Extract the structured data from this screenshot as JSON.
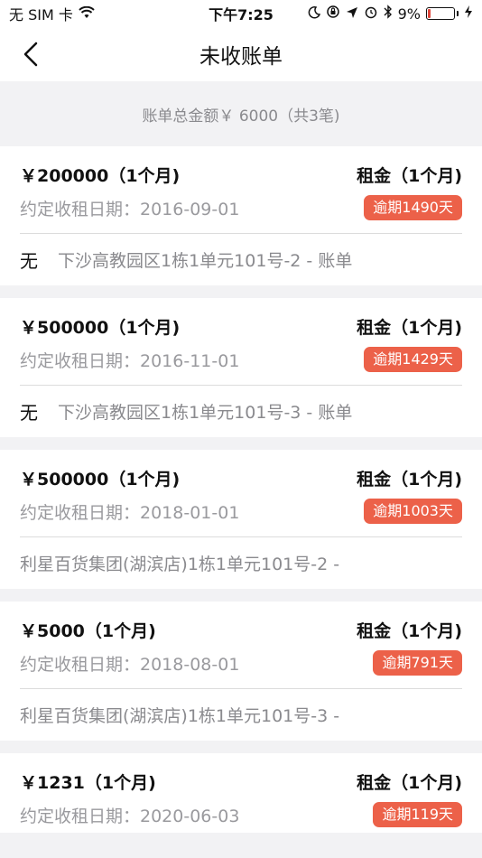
{
  "status_bar": {
    "carrier": "无 SIM 卡",
    "time": "下午7:25",
    "battery_percent": "9%",
    "battery_level": 0.09
  },
  "nav": {
    "title": "未收账单"
  },
  "summary": {
    "text": "账单总金额￥ 6000（共3笔)"
  },
  "bills": [
    {
      "amount": "￥200000（1个月)",
      "type": "租金（1个月)",
      "date": "约定收租日期：2016-09-01",
      "overdue": "逾期1490天",
      "tenant": "无",
      "address": "下沙高教园区1栋1单元101号-2 - 账单"
    },
    {
      "amount": "￥500000（1个月)",
      "type": "租金（1个月)",
      "date": "约定收租日期：2016-11-01",
      "overdue": "逾期1429天",
      "tenant": "无",
      "address": "下沙高教园区1栋1单元101号-3 - 账单"
    },
    {
      "amount": "￥500000（1个月)",
      "type": "租金（1个月)",
      "date": "约定收租日期：2018-01-01",
      "overdue": "逾期1003天",
      "tenant": "",
      "address": "利星百货集团(湖滨店)1栋1单元101号-2 -"
    },
    {
      "amount": "￥5000（1个月)",
      "type": "租金（1个月)",
      "date": "约定收租日期：2018-08-01",
      "overdue": "逾期791天",
      "tenant": "",
      "address": "利星百货集团(湖滨店)1栋1单元101号-3 -"
    },
    {
      "amount": "￥1231（1个月)",
      "type": "租金（1个月)",
      "date": "约定收租日期：2020-06-03",
      "overdue": "逾期119天",
      "tenant": "",
      "address": ""
    }
  ],
  "colors": {
    "overdue_badge": "#ec6149",
    "battery_low": "#e0463a"
  }
}
